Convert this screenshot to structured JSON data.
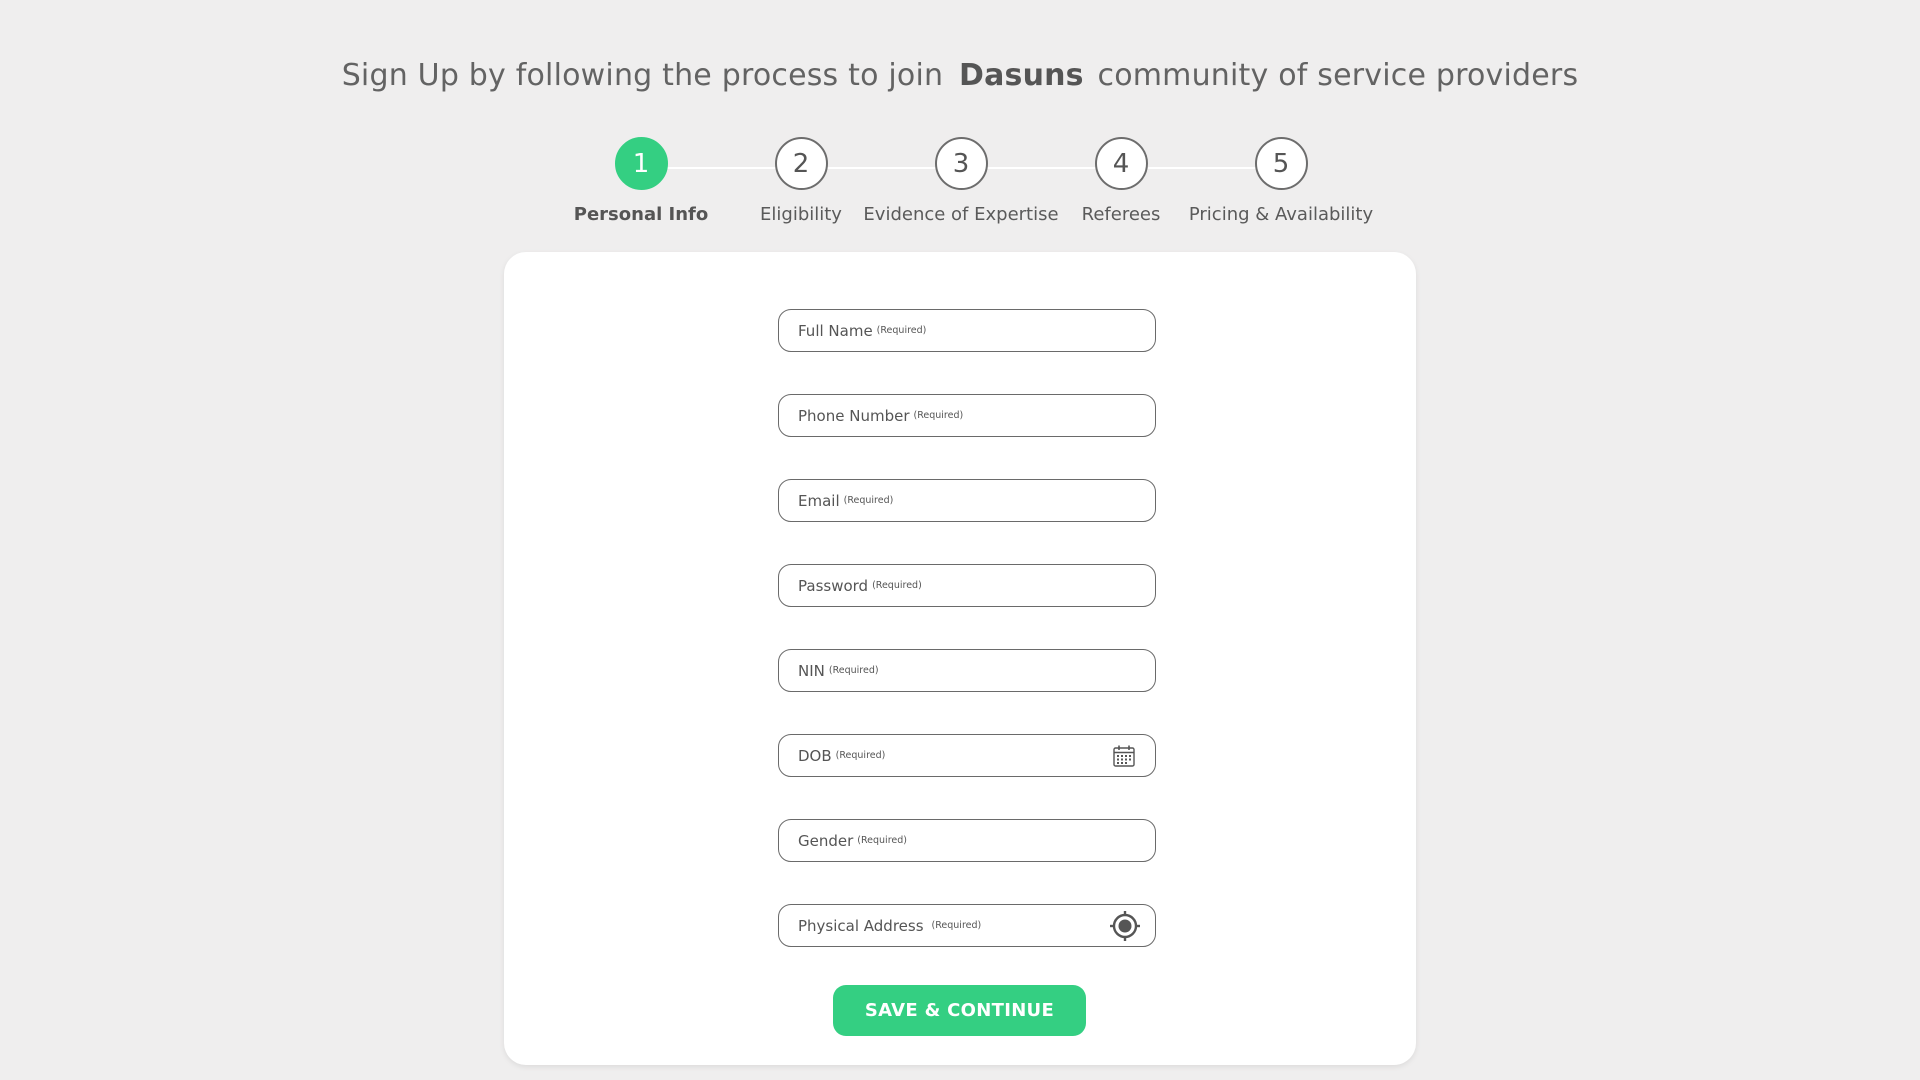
{
  "header": {
    "prefix": "Sign Up by following the process to join",
    "brand": "Dasuns",
    "suffix": "community of service providers"
  },
  "stepper": {
    "steps": [
      {
        "number": "1",
        "label": "Personal Info",
        "active": true
      },
      {
        "number": "2",
        "label": "Eligibility",
        "active": false
      },
      {
        "number": "3",
        "label": "Evidence of Expertise",
        "active": false
      },
      {
        "number": "4",
        "label": "Referees",
        "active": false
      },
      {
        "number": "5",
        "label": "Pricing & Availability",
        "active": false
      }
    ]
  },
  "form": {
    "required_tag": "(Required)",
    "fields": [
      {
        "label": "Full Name",
        "icon": null
      },
      {
        "label": "Phone Number",
        "icon": null
      },
      {
        "label": "Email",
        "icon": null
      },
      {
        "label": "Password",
        "icon": null
      },
      {
        "label": "NIN",
        "icon": null
      },
      {
        "label": "DOB",
        "icon": "calendar-icon"
      },
      {
        "label": "Gender",
        "icon": null
      },
      {
        "label": "Physical Address",
        "icon": "location-target-icon"
      }
    ],
    "submit_label": "SAVE & CONTINUE"
  },
  "colors": {
    "accent": "#34cf82",
    "background": "#efeeee",
    "card": "#ffffff"
  }
}
